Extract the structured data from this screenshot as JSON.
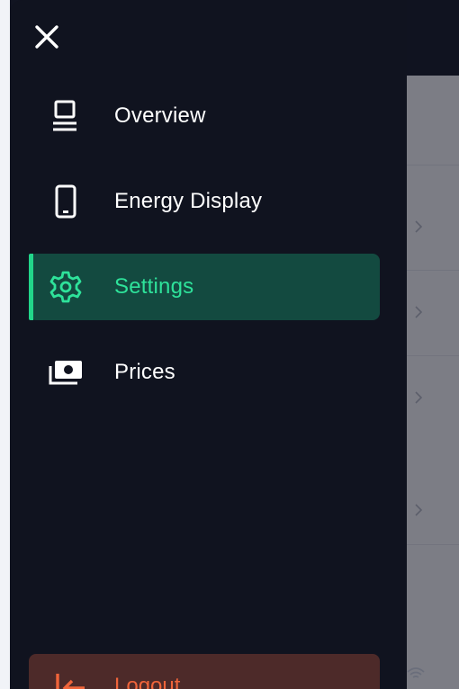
{
  "drawer": {
    "close_icon": "close-icon",
    "items": [
      {
        "label": "Overview",
        "icon": "laptop-icon",
        "active": false
      },
      {
        "label": "Energy Display",
        "icon": "phone-icon",
        "active": false
      },
      {
        "label": "Settings",
        "icon": "gear-icon",
        "active": true
      },
      {
        "label": "Prices",
        "icon": "money-icon",
        "active": false
      }
    ],
    "logout": {
      "label": "Logout",
      "icon": "logout-icon"
    }
  },
  "colors": {
    "drawer_bg": "#10131f",
    "active_bg": "#134a40",
    "active_accent": "#22d68a",
    "active_text": "#2ee29a",
    "logout_bg": "#4d2a29",
    "logout_text": "#f0643a"
  }
}
